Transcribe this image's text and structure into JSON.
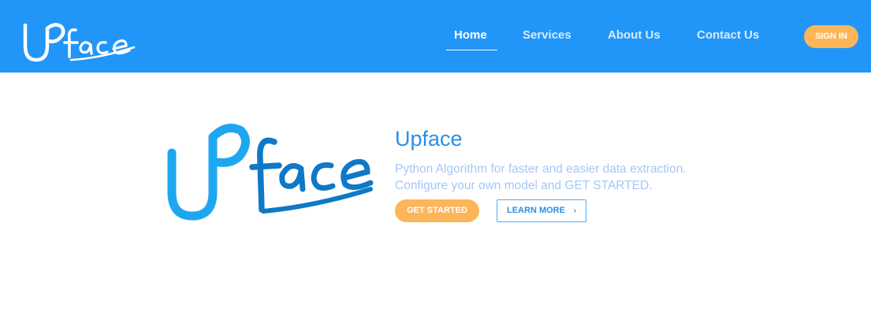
{
  "brand": {
    "name": "Upface",
    "logo_text_u": "U",
    "logo_text_p": "P",
    "logo_text_face": "face",
    "nav_color": "#2196f8",
    "accent_color": "#fdb55a",
    "hero_logo_primary": "#1ea7f0",
    "hero_logo_secondary": "#0e79c6"
  },
  "nav": {
    "items": [
      {
        "label": "Home",
        "active": true
      },
      {
        "label": "Services",
        "active": false
      },
      {
        "label": "About Us",
        "active": false
      },
      {
        "label": "Contact Us",
        "active": false
      }
    ],
    "signin_label": "SIGN IN"
  },
  "hero": {
    "title": "Upface",
    "subtitle_line1": "Python Algorithm for faster and easier data extraction.",
    "subtitle_line2": "Configure your own model and GET STARTED.",
    "get_started_label": "GET STARTED",
    "learn_more_label": "LEARN MORE",
    "learn_more_icon": "chevron-right-icon"
  }
}
